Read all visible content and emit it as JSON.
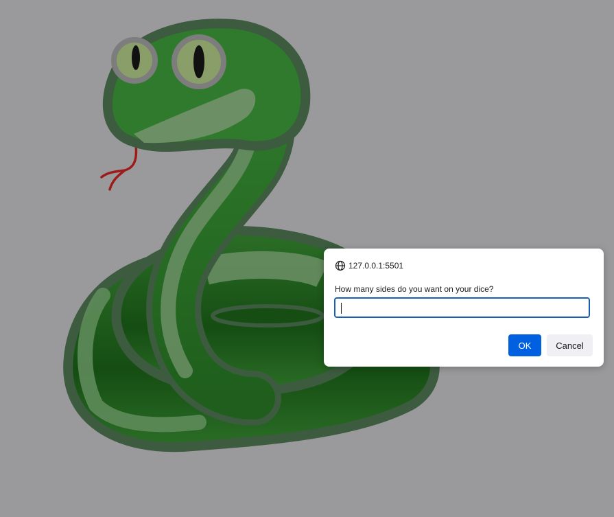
{
  "page": {
    "background_color": "#9a9a9c",
    "illustration": "snake-illustration"
  },
  "dialog": {
    "origin": "127.0.0.1:5501",
    "origin_icon": "globe-icon",
    "message": "How many sides do you want on your dice?",
    "input_value": "",
    "ok_label": "OK",
    "cancel_label": "Cancel",
    "accent_color": "#0060df"
  }
}
